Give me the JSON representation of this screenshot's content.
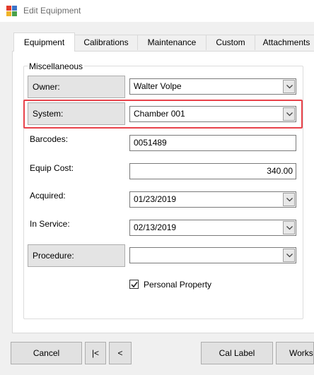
{
  "window": {
    "title": "Edit Equipment"
  },
  "tabs": [
    {
      "label": "Equipment",
      "active": true
    },
    {
      "label": "Calibrations",
      "active": false
    },
    {
      "label": "Maintenance",
      "active": false
    },
    {
      "label": "Custom",
      "active": false
    },
    {
      "label": "Attachments",
      "active": false
    }
  ],
  "group": {
    "title": "Miscellaneous"
  },
  "fields": {
    "owner": {
      "label": "Owner:",
      "value": "Walter Volpe"
    },
    "system": {
      "label": "System:",
      "value": "Chamber 001"
    },
    "barcodes": {
      "label": "Barcodes:",
      "value": "0051489"
    },
    "equip_cost": {
      "label": "Equip Cost:",
      "value": "340.00"
    },
    "acquired": {
      "label": "Acquired:",
      "value": "01/23/2019"
    },
    "in_service": {
      "label": "In Service:",
      "value": "02/13/2019"
    },
    "procedure": {
      "label": "Procedure:",
      "value": ""
    }
  },
  "personal_property": {
    "label": "Personal Property",
    "checked": true
  },
  "buttons": {
    "cancel": "Cancel",
    "first": "|<",
    "prev": "<",
    "cal_label": "Cal Label",
    "works": "Works"
  },
  "colors": {
    "highlight": "#e8424a",
    "window_bg": "#f0f0f0"
  }
}
